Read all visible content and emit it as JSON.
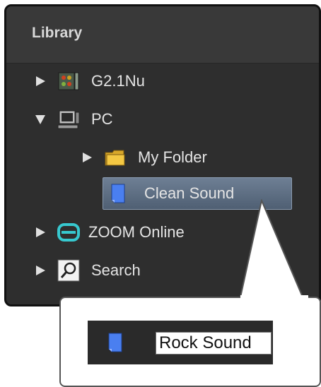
{
  "library": {
    "title": "Library",
    "items": [
      {
        "label": "G2.1Nu",
        "expanded": false,
        "icon": "device-icon"
      },
      {
        "label": "PC",
        "expanded": true,
        "icon": "computer-icon"
      },
      {
        "label": "My Folder",
        "expanded": false,
        "icon": "folder-icon"
      },
      {
        "label": "Clean Sound",
        "selected": true,
        "icon": "patch-icon"
      },
      {
        "label": "ZOOM Online",
        "expanded": false,
        "icon": "zoom-online-icon"
      },
      {
        "label": "Search",
        "expanded": false,
        "icon": "search-icon"
      }
    ]
  },
  "rename_callout": {
    "value": "Rock Sound",
    "icon": "patch-icon"
  },
  "colors": {
    "panel_bg": "#2e2e2e",
    "selection": "#5f6f84",
    "patch_blue": "#4a7ff0",
    "folder_yellow": "#f4c843",
    "zoom_teal": "#37c8cf"
  }
}
